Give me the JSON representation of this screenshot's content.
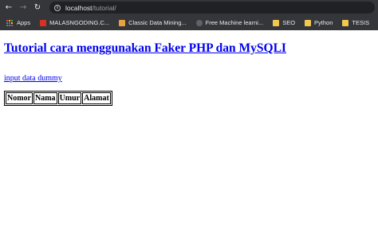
{
  "browser": {
    "url_host": "localhost",
    "url_path": "/tutorial/",
    "bookmarks": [
      {
        "label": "Apps",
        "icon": "apps-grid-icon"
      },
      {
        "label": "MALASNGODING.C...",
        "icon": "malasngoding-favicon"
      },
      {
        "label": "Classic Data Mining...",
        "icon": "classic-data-mining-favicon"
      },
      {
        "label": "Free Machine learni...",
        "icon": "globe-icon"
      },
      {
        "label": "SEO",
        "icon": "folder-icon"
      },
      {
        "label": "Python",
        "icon": "folder-icon"
      },
      {
        "label": "TESIS",
        "icon": "folder-icon"
      }
    ]
  },
  "page": {
    "title": "Tutorial cara menggunakan Faker PHP dan MySQLI",
    "input_link": "input data dummy",
    "table_headers": [
      "Nomor",
      "Nama",
      "Umur",
      "Alamat"
    ]
  }
}
